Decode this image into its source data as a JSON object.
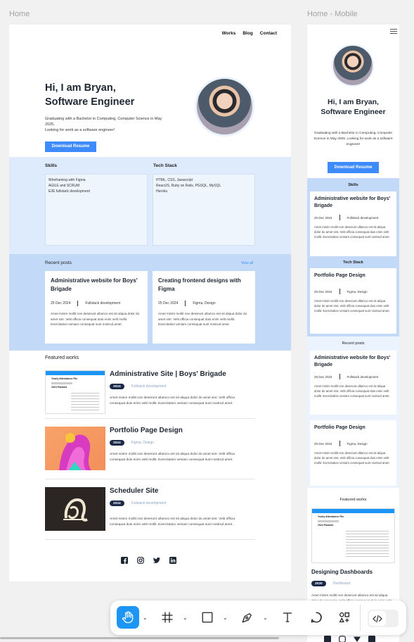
{
  "frames": {
    "desktop_label": "Home",
    "mobile_label": "Home - Mobile"
  },
  "nav": {
    "works": "Works",
    "blog": "Blog",
    "contact": "Contact"
  },
  "hero": {
    "line1": "Hi, I am Bryan,",
    "line2": "Software Engineer",
    "p1": "Graduating with a Bachelor in Computing, Computer Science in May 2025.",
    "p2": "Looking for work as a software engineer!",
    "button": "Download Resume"
  },
  "skills": {
    "title": "Skills",
    "items": [
      "Wireframing with Figma",
      "AGILE and SCRUM",
      "E2E fullstack development"
    ]
  },
  "tech": {
    "title": "Tech Stack",
    "items": [
      "HTML, CSS, Javascript",
      "ReactJS, Ruby on Rails, PGSQL, MySQL",
      "Heroku"
    ]
  },
  "recent": {
    "title": "Recent posts",
    "view_all": "View all",
    "posts": [
      {
        "title": "Administrative website for Boys' Brigade",
        "date": "25 Dec 2024",
        "tag": "Fullstack development",
        "body": "Amet minim mollit non deserunt ullamco est sit aliqua dolor do amet sint. Velit officia consequat duis enim velit mollit. Exercitation veniam consequat sunt nostrud amet."
      },
      {
        "title": "Creating frontend designs with Figma",
        "date": "25 Dec 2024",
        "tag": "Figma, Design",
        "body": "Amet minim mollit non deserunt ullamco est sit aliqua dolor do amet sint. Velit officia consequat duis enim velit mollit. Exercitation veniam consequat sunt nostrud amet."
      }
    ]
  },
  "featured": {
    "title": "Featured works",
    "works": [
      {
        "title": "Administrative Site | Boys' Brigade",
        "year": "2024",
        "tag": "Fullstack development",
        "body": "Amet minim mollit non deserunt ullamco est sit aliqua dolor do amet sint. Velit officia consequat duis enim velit mollit. Exercitation veniam consequat sunt nostrud amet."
      },
      {
        "title": "Portfolio Page Design",
        "year": "2024",
        "tag": "Figma, Design",
        "body": "Amet minim mollit non deserunt ullamco est sit aliqua dolor do amet sint. Velit officia consequat duis enim velit mollit. Exercitation veniam consequat sunt nostrud amet."
      },
      {
        "title": "Scheduler Site",
        "year": "2024",
        "tag": "Fullstack development",
        "body": "Amet minim mollit non deserunt ullamco est sit aliqua dolor do amet sint. Velit officia consequat duis enim velit mollit. Exercitation veniam consequat sunt nostrud amet."
      }
    ]
  },
  "thumb_doc": {
    "heading": "Yearly Attendance File",
    "sub": "2024 Parades"
  },
  "mobile": {
    "hero_p": "Graduating with a Bachelor in Computing, Computer Science in May 2025. Looking for work as a software engineer!",
    "skills_card": {
      "title": "Administrative website for Boys' Brigade",
      "date": "25 Dec 2024",
      "tag": "Fullstack development"
    },
    "tech_card": {
      "title": "Portfolio Page Design",
      "date": "25 Dec 2024",
      "tag": "Figma, Design"
    },
    "recent_cards": [
      {
        "title": "Administrative website for Boys' Brigade",
        "date": "25 Dec 2024",
        "tag": "Fullstack development"
      },
      {
        "title": "Portfolio Page Design",
        "date": "25 Dec 2024",
        "tag": "Figma, Design"
      }
    ],
    "work": {
      "title": "Designing Dashboards",
      "year": "2020",
      "tag": "Dashboard",
      "body": "Amet minim mollit non deserunt ullamco est sit aliqua dolor do amet sint. Velit officia consequat duis enim velit mollit."
    }
  },
  "toolbar": {
    "tools": [
      "hand-tool",
      "frame-tool",
      "rectangle-tool",
      "pen-tool",
      "text-tool",
      "comment-tool",
      "components-tool"
    ],
    "active": "hand-tool",
    "dev_mode": "code-icon"
  },
  "colors": {
    "accent": "#3d8bfd",
    "band_light": "#deebfc",
    "band_mid": "#c2daf7",
    "badge": "#1c2a4a",
    "tool_active": "#1d95f5"
  }
}
